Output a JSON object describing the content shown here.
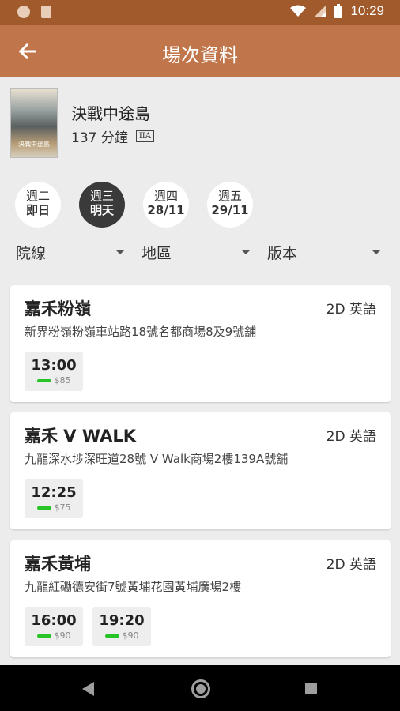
{
  "status_bar": {
    "time": "10:29",
    "icons": [
      "notification-dot-icon",
      "sd-card-icon",
      "wifi-icon",
      "signal-icon",
      "battery-icon"
    ]
  },
  "app_bar": {
    "title": "場次資料",
    "back_icon": "arrow-left-icon"
  },
  "movie": {
    "title": "決戰中途島",
    "duration": "137 分鐘",
    "rating": "IIA",
    "poster_text": "決戰中途島"
  },
  "dates": [
    {
      "day": "週二",
      "date": "即日",
      "active": false
    },
    {
      "day": "週三",
      "date": "明天",
      "active": true
    },
    {
      "day": "週四",
      "date": "28/11",
      "active": false
    },
    {
      "day": "週五",
      "date": "29/11",
      "active": false
    }
  ],
  "filters": {
    "chain": "院線",
    "region": "地區",
    "version": "版本"
  },
  "cinemas": [
    {
      "name": "嘉禾粉嶺",
      "version": "2D 英語",
      "address": "新界粉嶺粉嶺車站路18號名都商場8及9號舖",
      "showtimes": [
        {
          "time": "13:00",
          "price": "$85"
        }
      ]
    },
    {
      "name": "嘉禾 V WALK",
      "version": "2D 英語",
      "address": "九龍深水埗深旺道28號 V Walk商場2樓139A號舖",
      "showtimes": [
        {
          "time": "12:25",
          "price": "$75"
        }
      ]
    },
    {
      "name": "嘉禾黃埔",
      "version": "2D 英語",
      "address": "九龍紅磡德安街7號黃埔花園黃埔廣場2樓",
      "showtimes": [
        {
          "time": "16:00",
          "price": "$90"
        },
        {
          "time": "19:20",
          "price": "$90"
        }
      ]
    }
  ],
  "colors": {
    "status_bar": "#a05a2c",
    "app_bar": "#c0764a",
    "availability": "#27c427"
  }
}
